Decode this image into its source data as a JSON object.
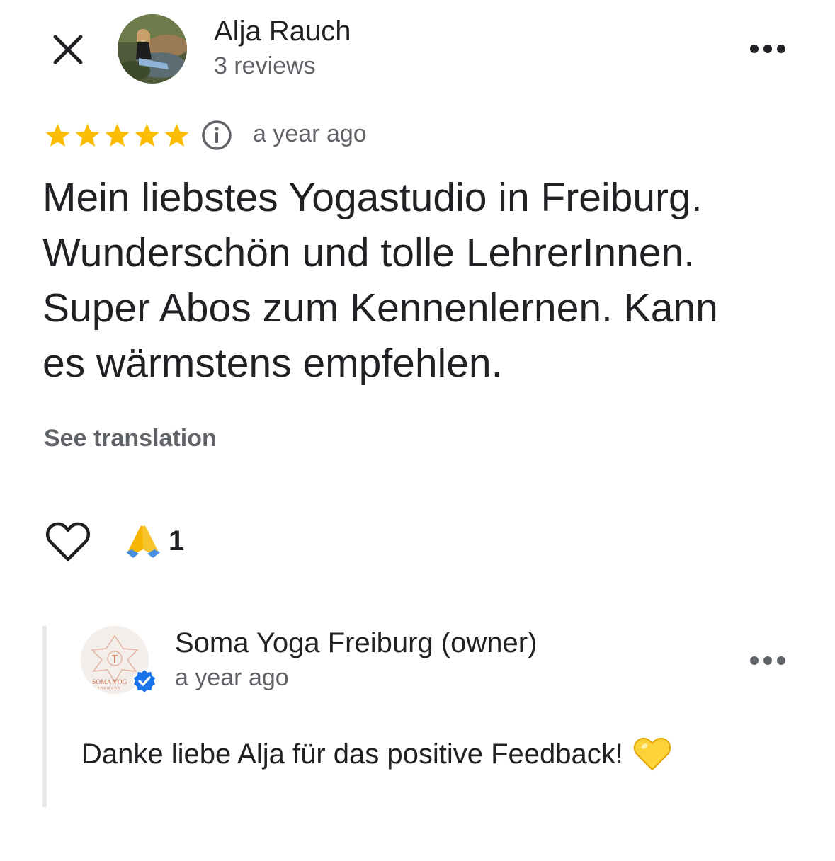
{
  "header": {
    "close_icon": "close-icon",
    "reviewer_name": "Alja Rauch",
    "reviewer_reviews": "3 reviews",
    "more_icon": "more-horizontal-icon"
  },
  "review": {
    "rating": 5,
    "rating_max": 5,
    "star_color": "#fbbc04",
    "info_icon": "info-icon",
    "time": "a year ago",
    "text": "Mein liebstes Yogastudio in Freiburg.\nWunderschön und tolle LehrerInnen.\nSuper Abos zum Kennenlernen. Kann\nes wärmstens empfehlen.",
    "see_translation": "See translation"
  },
  "reactions": {
    "like_icon": "heart-outline-icon",
    "emoji": "🙏",
    "count": "1"
  },
  "owner_response": {
    "name": "Soma Yoga Freiburg (owner)",
    "time": "a year ago",
    "avatar_text": "SOMA YOG",
    "avatar_subtext": "FREIBURG",
    "verified_color": "#1a73e8",
    "reply": "Danke liebe Alja für das positive Feedback!",
    "reply_emoji": "💛",
    "more_icon": "more-horizontal-icon"
  }
}
